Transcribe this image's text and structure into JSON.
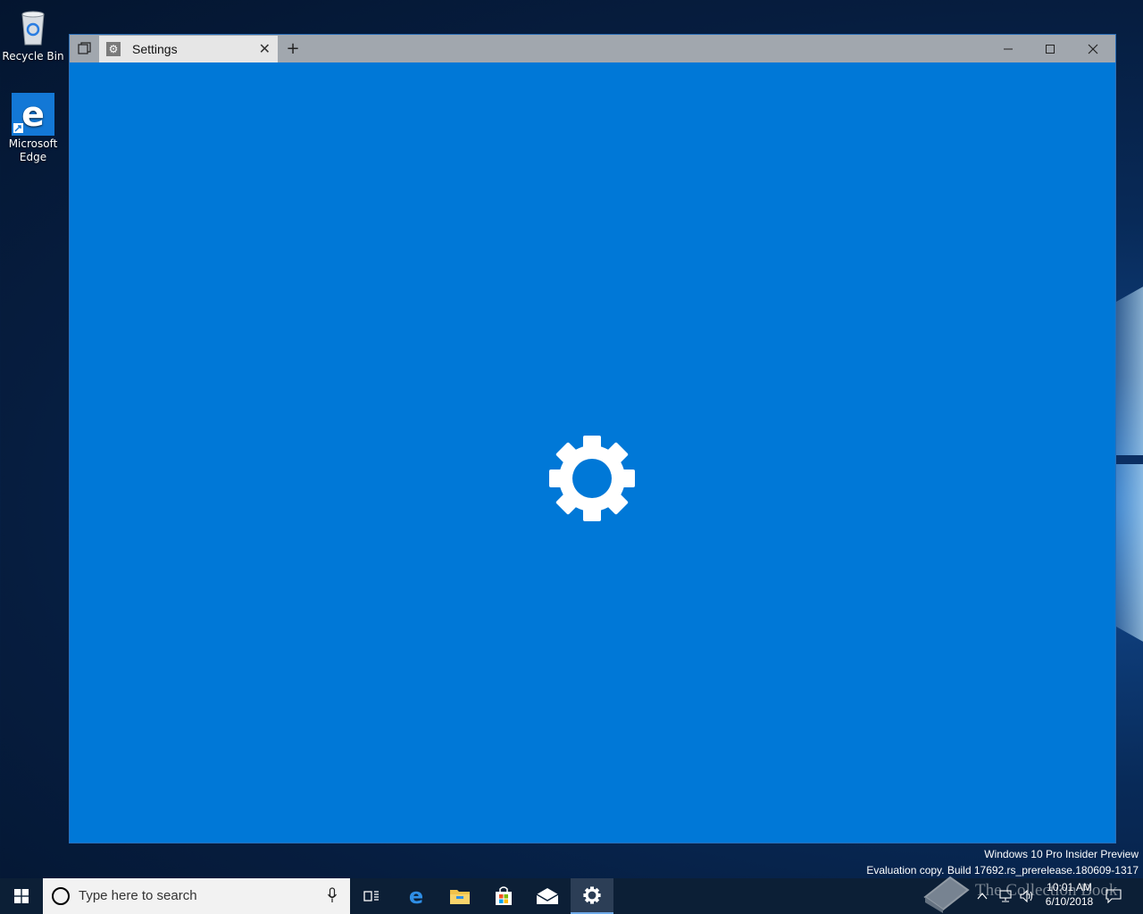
{
  "desktop": {
    "icons": [
      {
        "label": "Recycle Bin",
        "icon": "recycle-bin-icon"
      },
      {
        "label": "Microsoft Edge",
        "icon": "edge-icon"
      }
    ]
  },
  "window": {
    "tab": {
      "title": "Settings",
      "icon": "gear-icon"
    },
    "buttons": {
      "minimize": "—",
      "maximize": "□",
      "close": "✕",
      "new_tab": "+"
    },
    "accent": "#0078d7"
  },
  "watermark": {
    "line1": "Windows 10 Pro Insider Preview",
    "line2": "Evaluation copy. Build 17692.rs_prerelease.180609-1317"
  },
  "taskbar": {
    "search_placeholder": "Type here to search",
    "apps": [
      "task-view-icon",
      "edge-icon",
      "file-explorer-icon",
      "store-icon",
      "mail-icon",
      "settings-icon"
    ],
    "clock": {
      "time": "10:01 AM",
      "date": "6/10/2018"
    },
    "overlay_text": "The Collection Book"
  }
}
